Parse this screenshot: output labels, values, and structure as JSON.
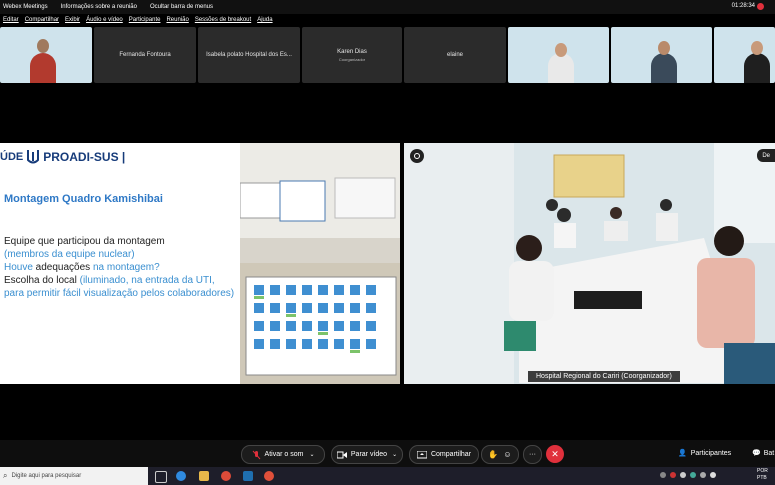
{
  "titlebar": {
    "app": "Webex Meetings",
    "info": "Informações sobre a reunião",
    "hide_menu": "Ocultar barra de menus",
    "time": "01:28:34"
  },
  "menubar": [
    "Editar",
    "Compartilhar",
    "Exibir",
    "Áudio e vídeo",
    "Participante",
    "Reunião",
    "Sessões de breakout",
    "Ajuda"
  ],
  "participants": [
    {
      "name": "",
      "video": true
    },
    {
      "name": "Fernanda Fontoura",
      "video": false
    },
    {
      "name": "Isabela polato Hospital dos Es...",
      "video": false
    },
    {
      "name": "Karen Dias",
      "role": "Coorganizador",
      "video": false
    },
    {
      "name": "elaine",
      "video": false
    },
    {
      "name": "",
      "video": true
    },
    {
      "name": "",
      "video": true
    },
    {
      "name": "",
      "video": true
    }
  ],
  "slide": {
    "logo_left": "ÚDE",
    "logo_right": "PROADI-SUS |",
    "title": "Montagem Quadro Kamishibai",
    "line1": "Equipe que participou da montagem",
    "line2": "(membros da equipe nuclear)",
    "line3a": "Houve",
    "line3b": " adequações ",
    "line3c": "na montagem?",
    "line4a": "Escolha do local ",
    "line4b": "(iluminado, na entrada da UTI, para permitir fácil visualização pelos colaboradores)"
  },
  "main_video": {
    "caption": "Hospital Regional do Cariri  (Coorganizador)",
    "badge": "De"
  },
  "toolbar": {
    "mute": "Ativar o som",
    "video": "Parar vídeo",
    "share": "Compartilhar",
    "participants": "Participantes",
    "chat": "Bat"
  },
  "taskbar": {
    "search_placeholder": "Digite aqui para pesquisar",
    "lang1": "POR",
    "lang2": "PTB"
  },
  "colors": {
    "accent_blue": "#2f79c6",
    "end_red": "#e0303c"
  }
}
